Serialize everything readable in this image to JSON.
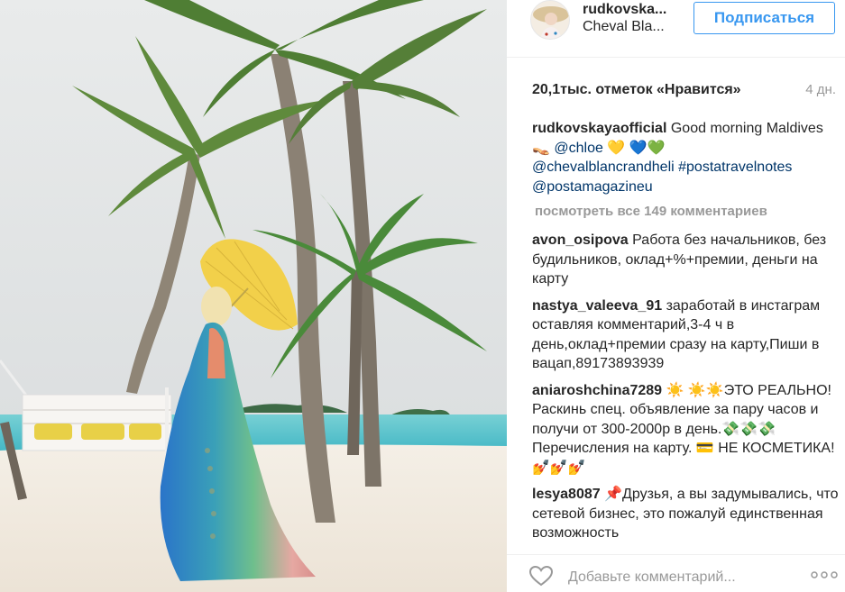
{
  "header": {
    "username": "rudkovska...",
    "location": "Cheval Bla...",
    "follow_label": "Подписаться"
  },
  "likes": {
    "text": "20,1тыс. отметок «Нравится»",
    "time_ago": "4 дн."
  },
  "caption": {
    "author": "rudkovskayaofficial",
    "text_1": " Good morning Maldives 👡 ",
    "mention_1": "@chloe",
    "text_2": " 💛 💙💚",
    "mention_2": "@chevalblancrandheli",
    "hashtag": "#postatravelnotes",
    "mention_3": "@postamagazineu"
  },
  "view_all_comments": "посмотреть все 149 комментариев",
  "comments": [
    {
      "author": "avon_osipova",
      "text": " Работа без начальников, без будильников, оклад+%+премии, деньги на карту"
    },
    {
      "author": "nastya_valeeva_91",
      "text": " заработай в инстаграм оставляя комментарий,3-4 ч в день,оклад+премии сразу на карту,Пиши в вацап,89173893939"
    },
    {
      "author": "aniaroshchina7289",
      "text": " ☀️ ☀️☀️ЭТО РЕАЛЬНО! Раскинь спец. объявление за пару часов и получи от 300-2000р в день.💸💸💸 Перечисления на карту. 💳 НЕ КОСМЕТИКА!💅💅💅"
    },
    {
      "author": "lesya8087",
      "text": " 📌Друзья, а вы задумывались, что сетевой бизнес, это пожалуй единственная возможность"
    }
  ],
  "footer": {
    "add_comment_placeholder": "Добавьте комментарий..."
  },
  "colors": {
    "accent": "#3897f0",
    "link": "#003569",
    "muted": "#999999",
    "sky": "#dfe3e6",
    "sand": "#f1ebe2",
    "sea": "#5cc3cc",
    "umbrella": "#f2d04a"
  },
  "icons": {
    "like": "heart-icon",
    "more": "more-options-icon"
  }
}
